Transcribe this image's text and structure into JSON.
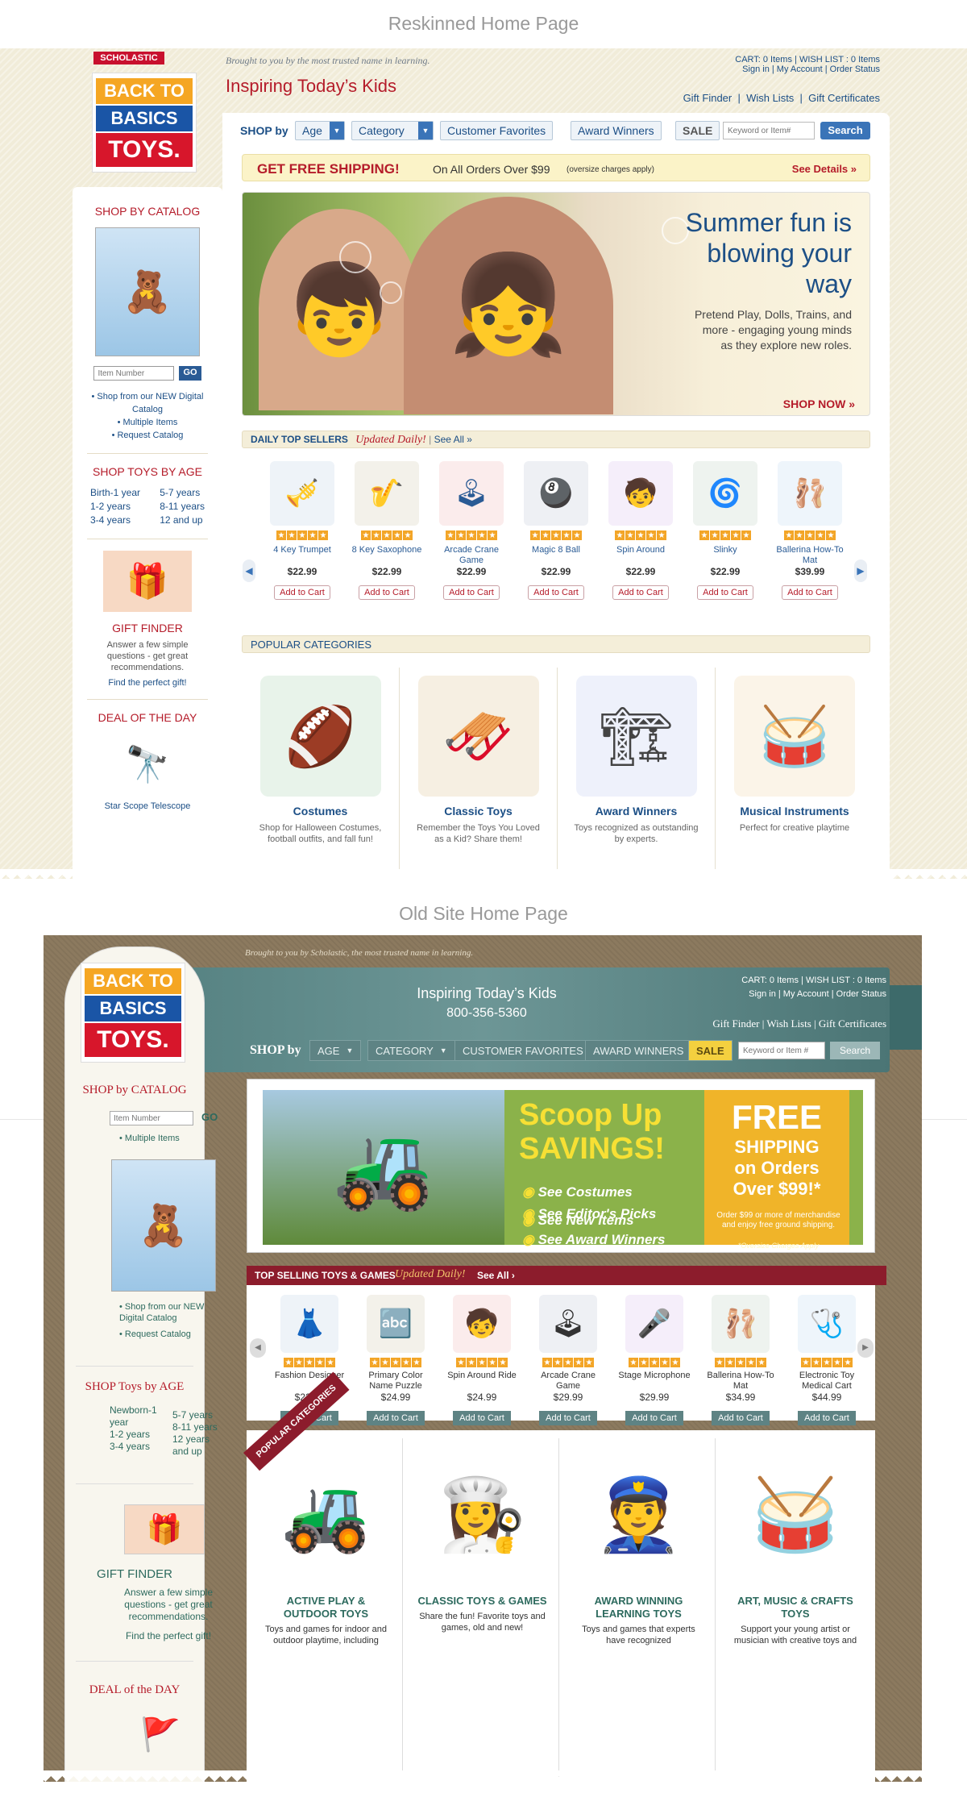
{
  "reskin_label": "Reskinned Home Page",
  "old_label": "Old Site Home Page",
  "reskin": {
    "scholastic": "SCHOLASTIC",
    "logo": [
      "BACK TO",
      "BASICS",
      "TOYS."
    ],
    "brought": "Brought to you by the most trusted name in learning.",
    "tagline": "Inspiring Today’s Kids",
    "cart": "CART: 0 Items",
    "wishlist": "WISH LIST : 0 Items",
    "signin": "Sign in",
    "account": "My Account",
    "order": "Order Status",
    "gift_finder": "Gift Finder",
    "wish_lists": "Wish Lists",
    "gift_certs": "Gift Certificates",
    "shop_by": "SHOP by",
    "age": "Age",
    "category": "Category",
    "favorites": "Customer Favorites",
    "awards": "Award Winners",
    "sale": "SALE",
    "search_placeholder": "Keyword or Item#",
    "search": "Search",
    "ship_title": "GET FREE SHIPPING!",
    "ship_text": "On All Orders Over $99",
    "ship_note": "(oversize charges apply)",
    "ship_details": "See Details »",
    "hero_title": "Summer fun is blowing your way",
    "hero_text": "Pretend Play, Dolls, Trains, and more - engaging young minds as they explore new roles.",
    "hero_cta": "SHOP NOW »",
    "shop_catalog": "SHOP BY CATALOG",
    "item_placeholder": "Item Number",
    "go": "GO",
    "catalog_links": [
      "• Shop from our NEW Digital Catalog",
      "• Multiple Items",
      "• Request Catalog"
    ],
    "shop_age": "SHOP TOYS BY AGE",
    "ages_left": [
      "Birth-1 year",
      "1-2 years",
      "3-4 years"
    ],
    "ages_right": [
      "5-7 years",
      "8-11 years",
      "12 and up"
    ],
    "gf_title": "GIFT FINDER",
    "gf_text": "Answer a few simple questions - get great recommendations.",
    "gf_link": "Find the perfect gift!",
    "deal": "DEAL OF THE DAY",
    "deal_item": "Star Scope Telescope",
    "daily": "DAILY TOP SELLERS",
    "updated": "Updated Daily!",
    "see_all": "See All »",
    "add": "Add to Cart",
    "products": [
      {
        "name": "4 Key Trumpet",
        "price": "$22.99",
        "icon": "🎺"
      },
      {
        "name": "8 Key Saxophone",
        "price": "$22.99",
        "icon": "🎷"
      },
      {
        "name": "Arcade Crane Game",
        "price": "$22.99",
        "icon": "🕹"
      },
      {
        "name": "Magic 8 Ball",
        "price": "$22.99",
        "icon": "🎱"
      },
      {
        "name": "Spin Around",
        "price": "$22.99",
        "icon": "🧒"
      },
      {
        "name": "Slinky",
        "price": "$22.99",
        "icon": "🌀"
      },
      {
        "name": "Ballerina How-To Mat",
        "price": "$39.99",
        "icon": "🩰"
      }
    ],
    "popular": "POPULAR CATEGORIES",
    "cats": [
      {
        "title": "Costumes",
        "text": "Shop for Halloween Costumes, football outfits, and fall fun!",
        "icon": "🏈"
      },
      {
        "title": "Classic Toys",
        "text": "Remember the Toys You Loved as a Kid? Share them!",
        "icon": "🛷"
      },
      {
        "title": "Award Winners",
        "text": "Toys recognized as outstanding by experts.",
        "icon": "🏗"
      },
      {
        "title": "Musical Instruments",
        "text": "Perfect for creative playtime",
        "icon": "🥁"
      }
    ]
  },
  "old": {
    "logo": [
      "BACK TO",
      "BASICS",
      "TOYS."
    ],
    "brought": "Brought to you by Scholastic, the most trusted name in learning.",
    "tagline": "Inspiring Today’s Kids",
    "phone": "800-356-5360",
    "cart": "CART: 0 Items",
    "wishlist": "WISH LIST : 0 Items",
    "signin": "Sign in",
    "account": "My Account",
    "order": "Order Status",
    "gift_finder": "Gift Finder",
    "wish_lists": "Wish Lists",
    "gift_certs": "Gift Certificates",
    "shop_by": "SHOP by",
    "age": "AGE",
    "category": "CATEGORY",
    "favorites": "CUSTOMER FAVORITES",
    "awards": "AWARD WINNERS",
    "sale": "SALE",
    "search_placeholder": "Keyword or Item #",
    "search": "Search",
    "shop_catalog": "SHOP by CATALOG",
    "item_placeholder": "Item Number",
    "go": "GO",
    "multiple": "Multiple Items",
    "catalog_links": [
      "Shop from our NEW Digital Catalog",
      "Request Catalog"
    ],
    "shop_age": "SHOP Toys by AGE",
    "ages_left": [
      "Newborn-1 year",
      "1-2 years",
      "3-4 years"
    ],
    "ages_right": [
      "5-7 years",
      "8-11 years",
      "12 years and up"
    ],
    "gf_title": "GIFT FINDER",
    "gf_text": "Answer a few simple questions - get great recommendations.",
    "gf_link": "Find the perfect gift!",
    "deal": "DEAL of the DAY",
    "banner_title1": "Scoop Up",
    "banner_title2": "SAVINGS!",
    "banner_links": [
      "See Costumes",
      "See Editor's Picks",
      "See New Items",
      "See Award Winners"
    ],
    "free1": "FREE",
    "free2": "SHIPPING",
    "free3": "on Orders",
    "free4": "Over $99!*",
    "free5": "Order $99 or more of merchandise and enjoy free ground shipping.",
    "free6": "*Oversize Charges Apply",
    "top": "TOP SELLING TOYS & GAMES",
    "updated": "Updated Daily!",
    "see_all": "See All",
    "add": "Add to Cart",
    "products": [
      {
        "name": "Fashion Designer",
        "price": "$22.99",
        "icon": "👗"
      },
      {
        "name": "Primary Color Name Puzzle",
        "price": "$24.99",
        "icon": "🔤"
      },
      {
        "name": "Spin Around Ride",
        "price": "$24.99",
        "icon": "🧒"
      },
      {
        "name": "Arcade Crane Game",
        "price": "$29.99",
        "icon": "🕹"
      },
      {
        "name": "Stage Microphone",
        "price": "$29.99",
        "icon": "🎤"
      },
      {
        "name": "Ballerina How-To Mat",
        "price": "$34.99",
        "icon": "🩰"
      },
      {
        "name": "Electronic Toy Medical Cart",
        "price": "$44.99",
        "icon": "🩺"
      }
    ],
    "popular_flag": "POPULAR CATEGORIES",
    "cats": [
      {
        "title": "ACTIVE PLAY & OUTDOOR TOYS",
        "text": "Toys and games for indoor and outdoor playtime, including",
        "icon": "🚜"
      },
      {
        "title": "CLASSIC TOYS & GAMES",
        "text": "Share the fun! Favorite toys and games, old and new!",
        "icon": "👩‍🍳"
      },
      {
        "title": "AWARD WINNING LEARNING TOYS",
        "text": "Toys and games that experts have recognized",
        "icon": "👮"
      },
      {
        "title": "ART, MUSIC & CRAFTS TOYS",
        "text": "Support your young artist or musician with creative toys and",
        "icon": "🥁"
      }
    ]
  }
}
